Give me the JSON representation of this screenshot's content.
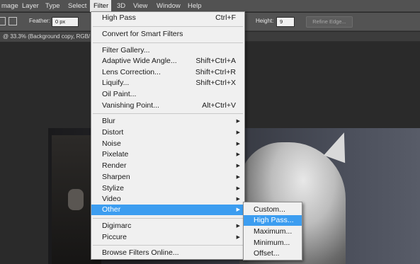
{
  "menubar": {
    "items": [
      "mage",
      "Layer",
      "Type",
      "Select",
      "Filter",
      "3D",
      "View",
      "Window",
      "Help"
    ],
    "active": "Filter"
  },
  "options": {
    "feather_label": "Feather:",
    "feather_value": "0 px",
    "height_label": "Height:",
    "height_value": "9",
    "refine_edge_label": "Refine Edge..."
  },
  "tab": {
    "label": "@ 33.3% (Background copy, RGB/"
  },
  "filter_menu": {
    "items": [
      {
        "label": "High Pass",
        "shortcut": "Ctrl+F"
      },
      {
        "label": "Convert for Smart Filters"
      },
      {
        "label": "Filter Gallery..."
      },
      {
        "label": "Adaptive Wide Angle...",
        "shortcut": "Shift+Ctrl+A"
      },
      {
        "label": "Lens Correction...",
        "shortcut": "Shift+Ctrl+R"
      },
      {
        "label": "Liquify...",
        "shortcut": "Shift+Ctrl+X"
      },
      {
        "label": "Oil Paint..."
      },
      {
        "label": "Vanishing Point...",
        "shortcut": "Alt+Ctrl+V"
      },
      {
        "label": "Blur",
        "submenu": true
      },
      {
        "label": "Distort",
        "submenu": true
      },
      {
        "label": "Noise",
        "submenu": true
      },
      {
        "label": "Pixelate",
        "submenu": true
      },
      {
        "label": "Render",
        "submenu": true
      },
      {
        "label": "Sharpen",
        "submenu": true
      },
      {
        "label": "Stylize",
        "submenu": true
      },
      {
        "label": "Video",
        "submenu": true
      },
      {
        "label": "Other",
        "submenu": true,
        "highlighted": true
      },
      {
        "label": "Digimarc",
        "submenu": true
      },
      {
        "label": "Piccure",
        "submenu": true
      },
      {
        "label": "Browse Filters Online..."
      }
    ]
  },
  "other_submenu": {
    "items": [
      {
        "label": "Custom..."
      },
      {
        "label": "High Pass...",
        "highlighted": true
      },
      {
        "label": "Maximum..."
      },
      {
        "label": "Minimum..."
      },
      {
        "label": "Offset..."
      }
    ]
  },
  "colors": {
    "highlight": "#3c9df0",
    "menu_bg": "#f0f0f0",
    "chrome_bg": "#535353"
  }
}
